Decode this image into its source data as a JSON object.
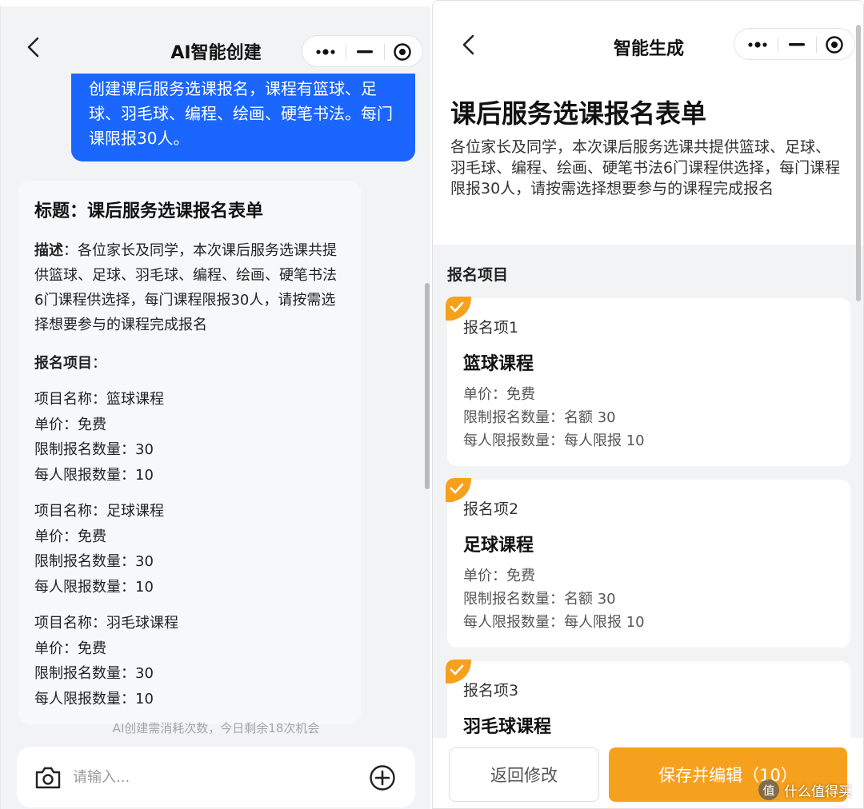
{
  "left": {
    "nav": {
      "title": "AI智能创建"
    },
    "user_message": "创建课后服务选课报名，课程有篮球、足球、羽毛球、编程、绘画、硬笔书法。每门课限报30人。",
    "reply": {
      "title": "标题：课后服务选课报名表单",
      "desc_label": "描述",
      "desc_text": "：各位家长及同学，本次课后服务选课共提供篮球、足球、羽毛球、编程、绘画、硬笔书法6门课程供选择，每门课程限报30人，请按需选择想要参与的课程完成报名",
      "items_label": "报名项目",
      "items_colon": "：",
      "items": [
        {
          "name": "项目名称：篮球课程",
          "price": "单价：免费",
          "limit": "限制报名数量：30",
          "per": "每人限报数量：10"
        },
        {
          "name": "项目名称：足球课程",
          "price": "单价：免费",
          "limit": "限制报名数量：30",
          "per": "每人限报数量：10"
        },
        {
          "name": "项目名称：羽毛球课程",
          "price": "单价：免费",
          "limit": "限制报名数量：30",
          "per": "每人限报数量：10"
        }
      ]
    },
    "ai_note": "AI创建需消耗次数，今日剩余18次机会",
    "input": {
      "placeholder": "请输入..."
    }
  },
  "right": {
    "nav": {
      "title": "智能生成"
    },
    "form_title": "课后服务选课报名表单",
    "form_desc": "各位家长及同学，本次课后服务选课共提供篮球、足球、羽毛球、编程、绘画、硬笔书法6门课程供选择，每门课程限报30人，请按需选择想要参与的课程完成报名",
    "section_label": "报名项目",
    "cards": [
      {
        "index": "报名项1",
        "name": "篮球课程",
        "price": "单价：免费",
        "limit": "限制报名数量：名额 30",
        "per": "每人限报数量：每人限报 10"
      },
      {
        "index": "报名项2",
        "name": "足球课程",
        "price": "单价：免费",
        "limit": "限制报名数量：名额 30",
        "per": "每人限报数量：每人限报 10"
      },
      {
        "index": "报名项3",
        "name": "羽毛球课程"
      }
    ],
    "buttons": {
      "back": "返回修改",
      "save": "保存并编辑（10）"
    }
  },
  "watermark": {
    "logo": "值",
    "text": "什么值得买"
  },
  "colors": {
    "accent_blue": "#1a66ff",
    "accent_orange": "#f6a11d",
    "background": "#f2f3f5"
  }
}
